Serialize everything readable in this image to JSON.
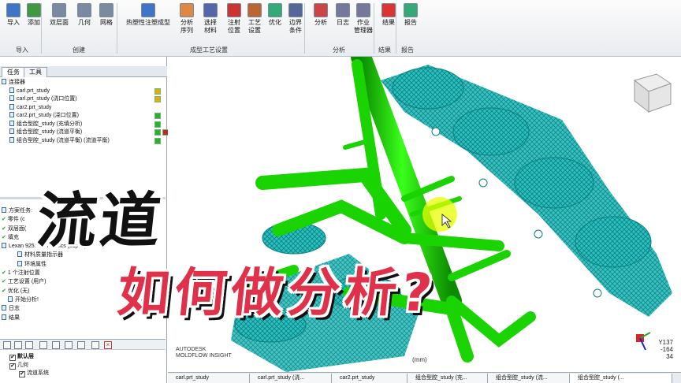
{
  "ribbon": {
    "buttons": [
      {
        "label": "导入",
        "icon": "import-icon",
        "color": "#3f74c9"
      },
      {
        "label": "添加",
        "icon": "add-icon",
        "color": "#3f9a3f"
      },
      {
        "label": "双层面",
        "icon": "dual-domain-icon",
        "color": "#7a8aa0"
      },
      {
        "label": "几何",
        "icon": "geometry-icon",
        "color": "#7a8aa0"
      },
      {
        "label": "网格",
        "icon": "mesh-icon",
        "color": "#7a8aa0"
      },
      {
        "label": "热塑性注塑成型",
        "icon": "thermoplastic-icon",
        "color": "#3f74c9"
      },
      {
        "label": "分析\n序列",
        "icon": "analysis-sequence-icon",
        "color": "#d84"
      },
      {
        "label": "选择\n材料",
        "icon": "material-icon",
        "color": "#56a"
      },
      {
        "label": "注射\n位置",
        "icon": "injection-location-icon",
        "color": "#c33"
      },
      {
        "label": "工艺\n设置",
        "icon": "process-settings-icon",
        "color": "#b63"
      },
      {
        "label": "优化",
        "icon": "optimize-icon",
        "color": "#3a7"
      },
      {
        "label": "边界\n条件",
        "icon": "boundary-icon",
        "color": "#569"
      },
      {
        "label": "分析",
        "icon": "analyze-icon",
        "color": "#c44"
      },
      {
        "label": "日志",
        "icon": "log-icon",
        "color": "#779"
      },
      {
        "label": "作业\n管理器",
        "icon": "job-manager-icon",
        "color": "#779"
      },
      {
        "label": "结果",
        "icon": "results-icon",
        "color": "#d33"
      },
      {
        "label": "报告",
        "icon": "report-icon",
        "color": "#3a7"
      }
    ],
    "groups": [
      "导入",
      "创建",
      "成型工艺设置",
      "分析",
      "结果",
      "报告"
    ]
  },
  "panel": {
    "tabs": [
      "任务",
      "工具"
    ],
    "tree_root": "连接器",
    "studies": [
      "carl.prt_study",
      "carl.prt_study (浇口位置)",
      "car2.prt_study",
      "car2.prt_study (浇口位置)",
      "组合型腔_study (充填分析)",
      "组合型腔_study (流道平衡)",
      "组合型腔_study (流道平衡) (流道平衡)"
    ],
    "task_items": [
      "方案任务:",
      "零件 (c",
      "双层面(",
      "填充",
      "Lexan 925: GE Plastics (Japan)",
      "材料质量指示器",
      "环境属性",
      "1 个注射位置",
      "工艺设置 (用户)",
      "优化 (无)",
      "开始分析!",
      "日志",
      "结果"
    ],
    "layers": [
      "默认层",
      "几何",
      "流道系统"
    ]
  },
  "viewport": {
    "coords": [
      "Y137",
      "-164",
      "34"
    ],
    "brand": "AUTODESK\nMOLDFLOW INSIGHT",
    "scale": "(mm)",
    "mesh_color": "#2bbfbf",
    "runner_color": "#19d400"
  },
  "overlay": {
    "line1": "流道",
    "line2": "如何做分析?"
  },
  "bottom_tabs": [
    "carl.prt_study",
    "carl.prt_study (浇...",
    "car2.prt_study",
    "组合型腔_study (充...",
    "组合型腔_study (流...",
    "组合型腔_study (..."
  ]
}
